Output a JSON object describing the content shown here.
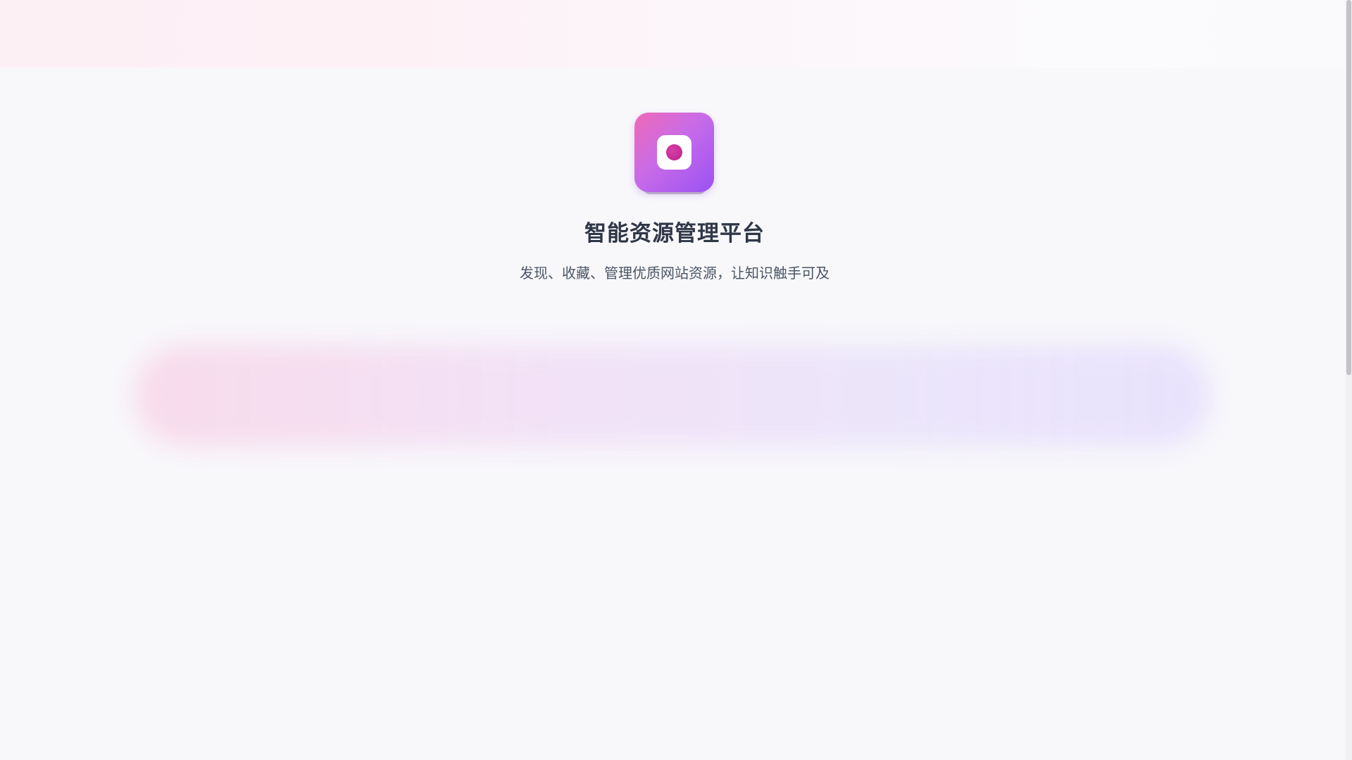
{
  "header": {
    "title": "智能资源管理平台",
    "tagline": "发现、收藏、管理优质网站资源，让知识触手可及"
  },
  "logo": {
    "icon": "app-logo-icon",
    "gradient_start": "#ef6ab7",
    "gradient_end": "#9a52f3",
    "dot_color": "#c02a96"
  },
  "colors": {
    "background": "#f8f8fb",
    "title": "#2f3747",
    "subtitle": "#4b5565"
  }
}
